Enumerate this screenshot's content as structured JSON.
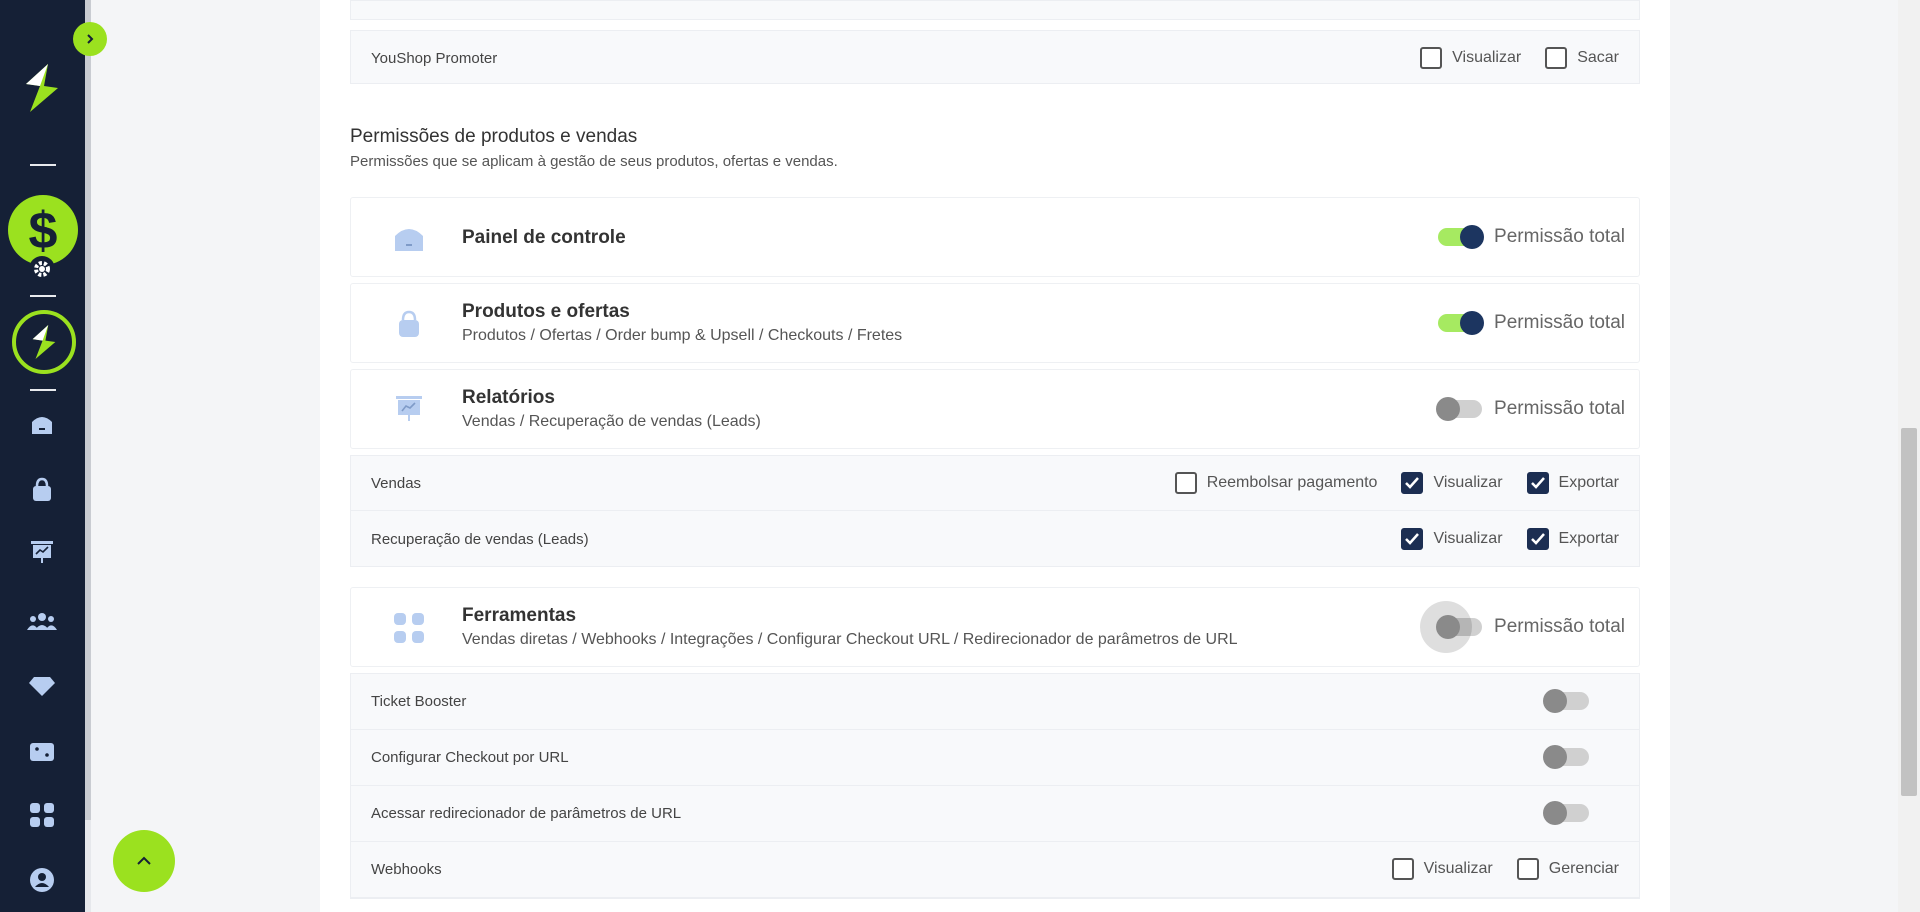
{
  "top_partial": {
    "youshop_promoter": {
      "label": "YouShop Promoter",
      "options": [
        {
          "label": "Visualizar",
          "checked": false
        },
        {
          "label": "Sacar",
          "checked": false
        }
      ]
    }
  },
  "section": {
    "title": "Permissões de produtos e vendas",
    "description": "Permissões que se aplicam à gestão de seus produtos, ofertas e vendas."
  },
  "cards": [
    {
      "title": "Painel de controle",
      "subtitle": "",
      "permission_label": "Permissão total",
      "toggle_on": true,
      "icon": "dashboard-home-icon"
    },
    {
      "title": "Produtos e ofertas",
      "subtitle": "Produtos / Ofertas / Order bump & Upsell / Checkouts / Fretes",
      "permission_label": "Permissão total",
      "toggle_on": true,
      "icon": "shopping-bag-icon"
    },
    {
      "title": "Relatórios",
      "subtitle": "Vendas / Recuperação de vendas (Leads)",
      "permission_label": "Permissão total",
      "toggle_on": false,
      "icon": "presentation-chart-icon"
    },
    {
      "title": "Ferramentas",
      "subtitle": "Vendas diretas / Webhooks / Integrações / Configurar Checkout URL / Redirecionador de parâmetros de URL",
      "permission_label": "Permissão total",
      "toggle_on": false,
      "icon": "apps-grid-icon"
    }
  ],
  "reports_rows": [
    {
      "label": "Vendas",
      "options": [
        {
          "label": "Reembolsar pagamento",
          "checked": false
        },
        {
          "label": "Visualizar",
          "checked": true
        },
        {
          "label": "Exportar",
          "checked": true
        }
      ]
    },
    {
      "label": "Recuperação de vendas (Leads)",
      "options": [
        {
          "label": "Visualizar",
          "checked": true
        },
        {
          "label": "Exportar",
          "checked": true
        }
      ]
    }
  ],
  "tools_rows": [
    {
      "label": "Ticket Booster",
      "toggle_on": false
    },
    {
      "label": "Configurar Checkout por URL",
      "toggle_on": false
    },
    {
      "label": "Acessar redirecionador de parâmetros de URL",
      "toggle_on": false
    },
    {
      "label": "Webhooks",
      "options": [
        {
          "label": "Visualizar",
          "checked": false
        },
        {
          "label": "Gerenciar",
          "checked": false
        }
      ]
    }
  ],
  "sidebar": {
    "nav_icons": [
      "home-icon",
      "bag-icon",
      "report-icon",
      "users-icon",
      "diamond-icon",
      "ticket-icon",
      "apps-icon",
      "profile-icon"
    ]
  },
  "colors": {
    "sidebar_bg": "#152036",
    "accent_green": "#9be11f",
    "navy": "#1c2e52",
    "icon_blue": "#b7cdf0"
  }
}
